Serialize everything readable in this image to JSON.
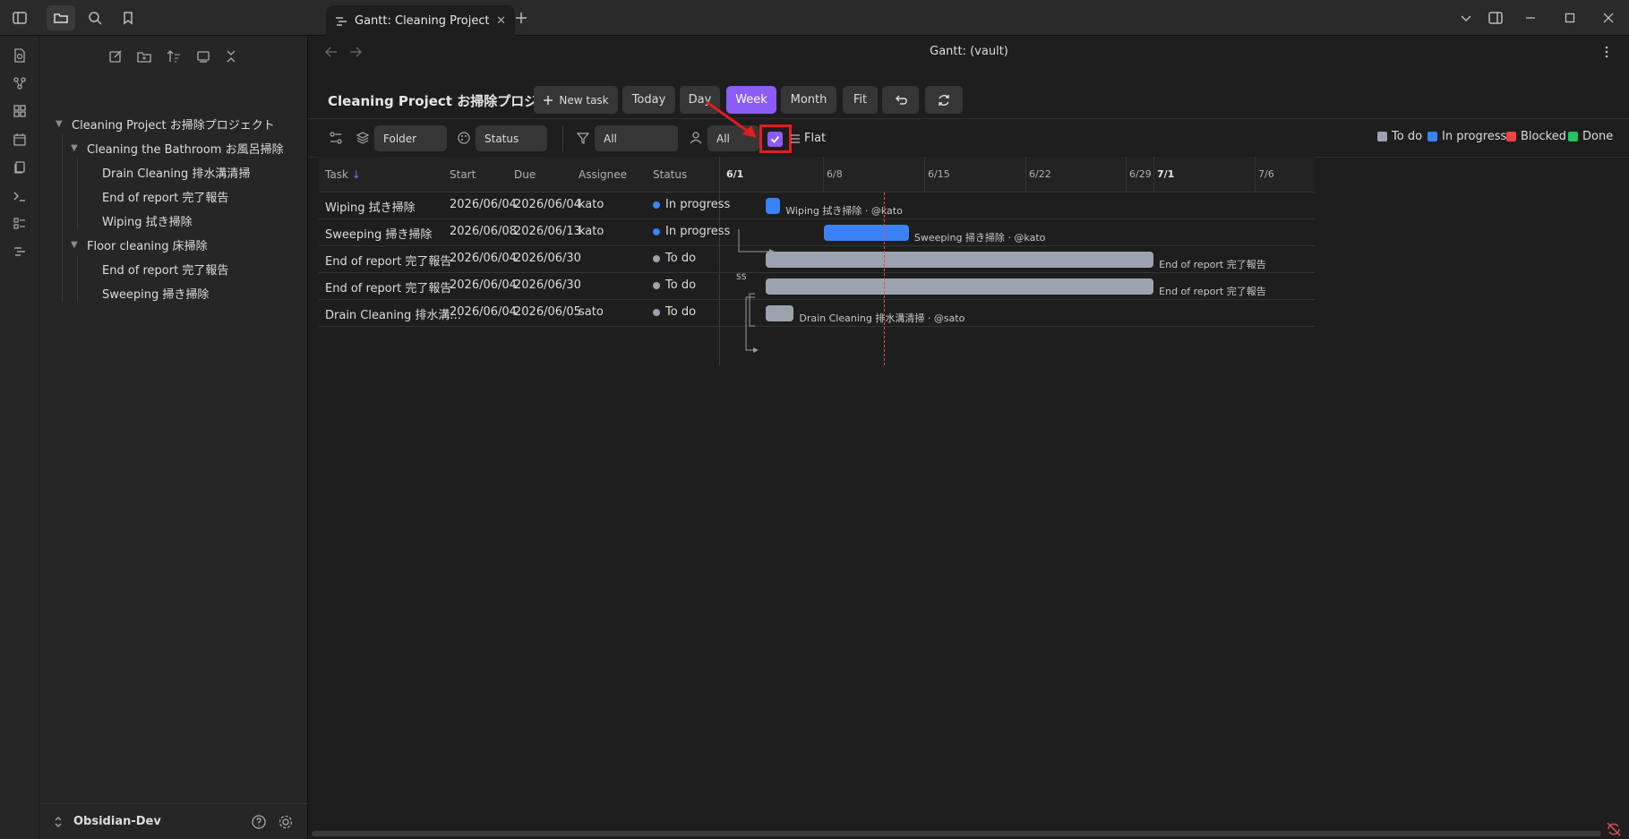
{
  "window": {
    "tab_title": "Gantt: Cleaning Project...",
    "view_title": "Gantt: (vault)"
  },
  "sidebar": {
    "tree": [
      {
        "label": "Cleaning Project お掃除プロジェクト",
        "level": 0,
        "folder": true
      },
      {
        "label": "Cleaning the Bathroom お風呂掃除",
        "level": 1,
        "folder": true
      },
      {
        "label": "Drain Cleaning 排水溝清掃",
        "level": 2,
        "folder": false
      },
      {
        "label": "End of report 完了報告",
        "level": 2,
        "folder": false
      },
      {
        "label": "Wiping 拭き掃除",
        "level": 2,
        "folder": false
      },
      {
        "label": "Floor cleaning 床掃除",
        "level": 1,
        "folder": true
      },
      {
        "label": "End of report 完了報告",
        "level": 2,
        "folder": false
      },
      {
        "label": "Sweeping 掃き掃除",
        "level": 2,
        "folder": false
      }
    ],
    "vault_name": "Obsidian-Dev"
  },
  "toolbar": {
    "project_title": "Cleaning Project お掃除プロジェクト",
    "new_task": "New task",
    "today": "Today",
    "day": "Day",
    "week": "Week",
    "month": "Month",
    "fit": "Fit",
    "active_zoom": "Week"
  },
  "filters": {
    "group_by": "Folder",
    "color_by": "Status",
    "filter_value": "All",
    "assignee_value": "All",
    "flat_checked": true,
    "flat_label": "Flat"
  },
  "legend": [
    {
      "label": "To do",
      "color": "#9ca3af"
    },
    {
      "label": "In progress",
      "color": "#3b82f6"
    },
    {
      "label": "Blocked",
      "color": "#ef4444"
    },
    {
      "label": "Done",
      "color": "#22c55e"
    }
  ],
  "table": {
    "headers": {
      "task": "Task",
      "start": "Start",
      "due": "Due",
      "assignee": "Assignee",
      "status": "Status"
    },
    "sort_indicator": "↓",
    "rows": [
      {
        "task": "Wiping 拭き掃除",
        "start": "2026/06/04",
        "due": "2026/06/04",
        "assignee": "kato",
        "status": "In progress",
        "status_color": "#3b82f6"
      },
      {
        "task": "Sweeping 掃き掃除",
        "start": "2026/06/08",
        "due": "2026/06/13",
        "assignee": "kato",
        "status": "In progress",
        "status_color": "#3b82f6"
      },
      {
        "task": "End of report 完了報告",
        "start": "2026/06/04",
        "due": "2026/06/30",
        "assignee": "",
        "status": "To do",
        "status_color": "#9ca3af"
      },
      {
        "task": "End of report 完了報告",
        "start": "2026/06/04",
        "due": "2026/06/30",
        "assignee": "",
        "status": "To do",
        "status_color": "#9ca3af"
      },
      {
        "task": "Drain Cleaning 排水溝...",
        "start": "2026/06/04",
        "due": "2026/06/05",
        "assignee": "sato",
        "status": "To do",
        "status_color": "#9ca3af"
      }
    ]
  },
  "timeline": {
    "date_headers": [
      "6/1",
      "6/8",
      "6/15",
      "6/22",
      "6/29",
      "7/1",
      "7/6"
    ],
    "bold_headers": [
      "6/1",
      "7/1"
    ],
    "bars": [
      {
        "label": "Wiping 拭き掃除 · @kato",
        "start": "2026/06/04",
        "end": "2026/06/04",
        "color": "#3b82f6"
      },
      {
        "label": "Sweeping 掃き掃除 · @kato",
        "start": "2026/06/08",
        "end": "2026/06/13",
        "color": "#3b82f6"
      },
      {
        "label": "End of report 完了報告",
        "start": "2026/06/04",
        "end": "2026/06/30",
        "color": "#9ca3af"
      },
      {
        "label": "End of report 完了報告",
        "start": "2026/06/04",
        "end": "2026/06/30",
        "color": "#9ca3af"
      },
      {
        "label": "Drain Cleaning 排水溝清掃 · @sato",
        "start": "2026/06/04",
        "end": "2026/06/05",
        "color": "#9ca3af"
      }
    ],
    "dependency_label": "SS"
  }
}
